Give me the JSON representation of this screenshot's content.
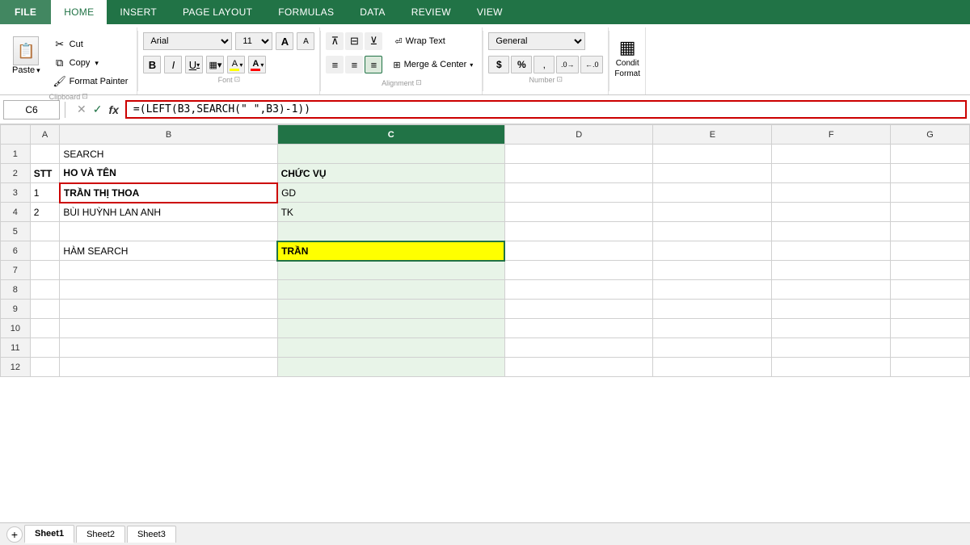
{
  "tabs": {
    "file": "FILE",
    "home": "HOME",
    "insert": "INSERT",
    "page_layout": "PAGE LAYOUT",
    "formulas": "FORMULAS",
    "data": "DATA",
    "review": "REVIEW",
    "view": "VIEW"
  },
  "clipboard": {
    "paste_label": "Paste",
    "cut_label": "Cut",
    "copy_label": "Copy",
    "format_painter_label": "Format Painter",
    "group_label": "Clipboard",
    "dialog_icon": "⊞"
  },
  "font": {
    "font_name": "Arial",
    "font_size": "11",
    "group_label": "Font",
    "dialog_icon": "⊞",
    "grow_icon": "A",
    "shrink_icon": "A",
    "bold": "B",
    "italic": "I",
    "underline": "U",
    "border_icon": "▦",
    "fill_icon": "A",
    "font_color_icon": "A"
  },
  "alignment": {
    "group_label": "Alignment",
    "dialog_icon": "⊞",
    "wrap_text": "Wrap Text",
    "merge_center": "Merge & Center",
    "align_icons": [
      "≡",
      "≡",
      "≡",
      "≡",
      "≡",
      "≡"
    ],
    "indent_icons": [
      "←",
      "→"
    ],
    "direction_icon": "⇲"
  },
  "number": {
    "group_label": "Number",
    "format_value": "General",
    "dialog_icon": "⊞",
    "currency": "$",
    "percent": "%",
    "comma": ",",
    "increase_decimal": ".0→",
    "decrease_decimal": "←.0"
  },
  "conditional": {
    "label_line1": "Condit",
    "label_line2": "Format"
  },
  "formula_bar": {
    "cell_ref": "C6",
    "formula": "=(LEFT(B3,SEARCH(\" \",B3)-1))",
    "cancel_icon": "✕",
    "confirm_icon": "✓",
    "fx_icon": "fx"
  },
  "spreadsheet": {
    "col_headers": [
      "A",
      "B",
      "C",
      "D",
      "E",
      "F",
      "G"
    ],
    "rows": [
      {
        "row": 1,
        "a": "",
        "b": "SEARCH",
        "c": "",
        "d": "",
        "e": "",
        "f": "",
        "g": ""
      },
      {
        "row": 2,
        "a": "STT",
        "b": "HO VÀ TÊN",
        "c": "CHỨC VỤ",
        "d": "",
        "e": "",
        "f": "",
        "g": ""
      },
      {
        "row": 3,
        "a": "1",
        "b": "TRẦN THỊ THOA",
        "c": "GD",
        "d": "",
        "e": "",
        "f": "",
        "g": ""
      },
      {
        "row": 4,
        "a": "2",
        "b": "BÙI HUỲNH LAN ANH",
        "c": "TK",
        "d": "",
        "e": "",
        "f": "",
        "g": ""
      },
      {
        "row": 5,
        "a": "",
        "b": "",
        "c": "",
        "d": "",
        "e": "",
        "f": "",
        "g": ""
      },
      {
        "row": 6,
        "a": "",
        "b": "HÀM SEARCH",
        "c": "TRẦN",
        "d": "",
        "e": "",
        "f": "",
        "g": ""
      },
      {
        "row": 7,
        "a": "",
        "b": "",
        "c": "",
        "d": "",
        "e": "",
        "f": "",
        "g": ""
      },
      {
        "row": 8,
        "a": "",
        "b": "",
        "c": "",
        "d": "",
        "e": "",
        "f": "",
        "g": ""
      },
      {
        "row": 9,
        "a": "",
        "b": "",
        "c": "",
        "d": "",
        "e": "",
        "f": "",
        "g": ""
      },
      {
        "row": 10,
        "a": "",
        "b": "",
        "c": "",
        "d": "",
        "e": "",
        "f": "",
        "g": ""
      },
      {
        "row": 11,
        "a": "",
        "b": "",
        "c": "",
        "d": "",
        "e": "",
        "f": "",
        "g": ""
      },
      {
        "row": 12,
        "a": "",
        "b": "",
        "c": "",
        "d": "",
        "e": "",
        "f": "",
        "g": ""
      }
    ]
  },
  "sheet_tabs": [
    "Sheet1",
    "Sheet2",
    "Sheet3"
  ]
}
